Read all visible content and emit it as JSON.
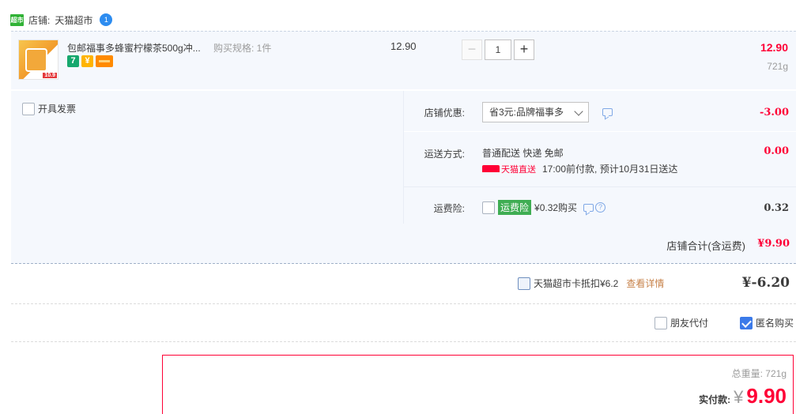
{
  "shop": {
    "logo_text": "超市",
    "label": "店铺:",
    "name": "天猫超市",
    "badge": "1"
  },
  "item": {
    "title": "包邮福事多蜂蜜柠檬茶500g冲...",
    "spec": "购买规格: 1件",
    "unit_price": "12.90",
    "quantity": "1",
    "minus": "−",
    "plus": "+",
    "total": "12.90",
    "weight": "721g",
    "thumb_price": "10.9",
    "icons": [
      "seven-day-return-icon",
      "shield-icon",
      "card-icon"
    ],
    "icon_7": "7",
    "icon_shield": "¥"
  },
  "options": {
    "invoice_label": "开具发票",
    "shop_discount": {
      "label": "店铺优惠:",
      "selected": "省3元:品牌福事多",
      "value": "-3.00"
    },
    "shipping": {
      "label": "运送方式:",
      "method": "普通配送 快递 免邮",
      "tmall_direct": "天猫直送",
      "eta": "17:00前付款, 预计10月31日送达",
      "value": "0.00"
    },
    "insurance": {
      "label": "运费险:",
      "tag": "运费险",
      "price": "¥0.32购买",
      "help": "?",
      "value": "0.32"
    }
  },
  "shop_total": {
    "label": "店铺合计(含运费)",
    "value": "¥9.90"
  },
  "card": {
    "label": "天猫超市卡抵扣¥6.2",
    "link": "查看详情",
    "amount": "¥-6.20"
  },
  "payment_options": {
    "friend_pay": "朋友代付",
    "anonymous": "匿名购买",
    "anonymous_checked": true
  },
  "summary": {
    "weight_label": "总重量: 721g",
    "pay_label": "实付款:",
    "currency": "¥",
    "amount": "9.90"
  },
  "colors": {
    "accent": "#ff0036",
    "panel": "#f5f8fd",
    "checkbox": "#3b7ae9",
    "tmall_green": "#31b236"
  }
}
